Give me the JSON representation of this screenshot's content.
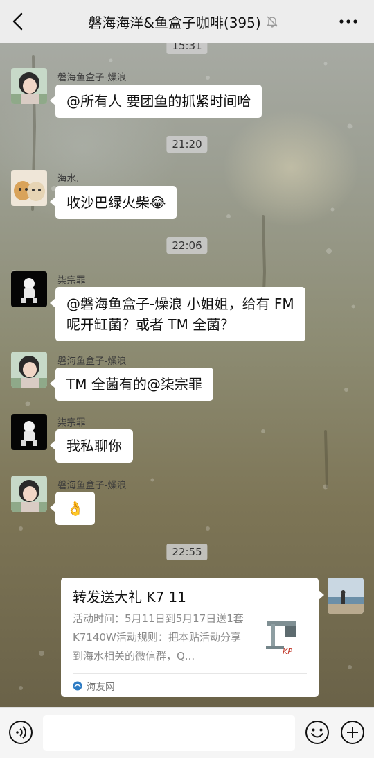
{
  "header": {
    "title": "磐海海洋&鱼盒子咖啡(395)",
    "back_icon": "back-chevron-icon",
    "mute_icon": "bell-muted-icon",
    "more_icon": "more-dots-icon"
  },
  "messages": {
    "partial_time": "15:31",
    "m1": {
      "sender": "磐海鱼盒子-燥浪",
      "text": "@所有人  要团鱼的抓紧时间哈"
    },
    "t1": "21:20",
    "m2": {
      "sender": "海水.",
      "text": "收沙巴绿火柴😂"
    },
    "t2": "22:06",
    "m3": {
      "sender": "柒宗罪",
      "line1": "@磐海鱼盒子-燥浪  小姐姐，给有 FM",
      "line2": "呢开缸菌？或者 TM 全菌？"
    },
    "m4": {
      "sender": "磐海鱼盒子-燥浪",
      "text": "TM 全菌有的@柒宗罪"
    },
    "m5": {
      "sender": "柒宗罪",
      "text": "我私聊你"
    },
    "m6": {
      "sender": "磐海鱼盒子-燥浪",
      "text": "👌"
    },
    "t3": "22:55"
  },
  "card": {
    "title": "转发送大礼 K7 11",
    "description": "活动时间：5月11日到5月17日送1套K7140W活动规则：把本贴活动分享到海水相关的微信群，Q...",
    "source": "海友网",
    "thumb_label": "KP"
  },
  "footer": {
    "input_placeholder": "",
    "voice_icon": "voice-icon",
    "emoji_icon": "emoji-icon",
    "plus_icon": "plus-icon"
  },
  "colors": {
    "header_bg": "#ededed",
    "bubble_bg": "#ffffff",
    "timestamp_bg": "#cecece",
    "footer_bg": "#f5f5f5"
  }
}
